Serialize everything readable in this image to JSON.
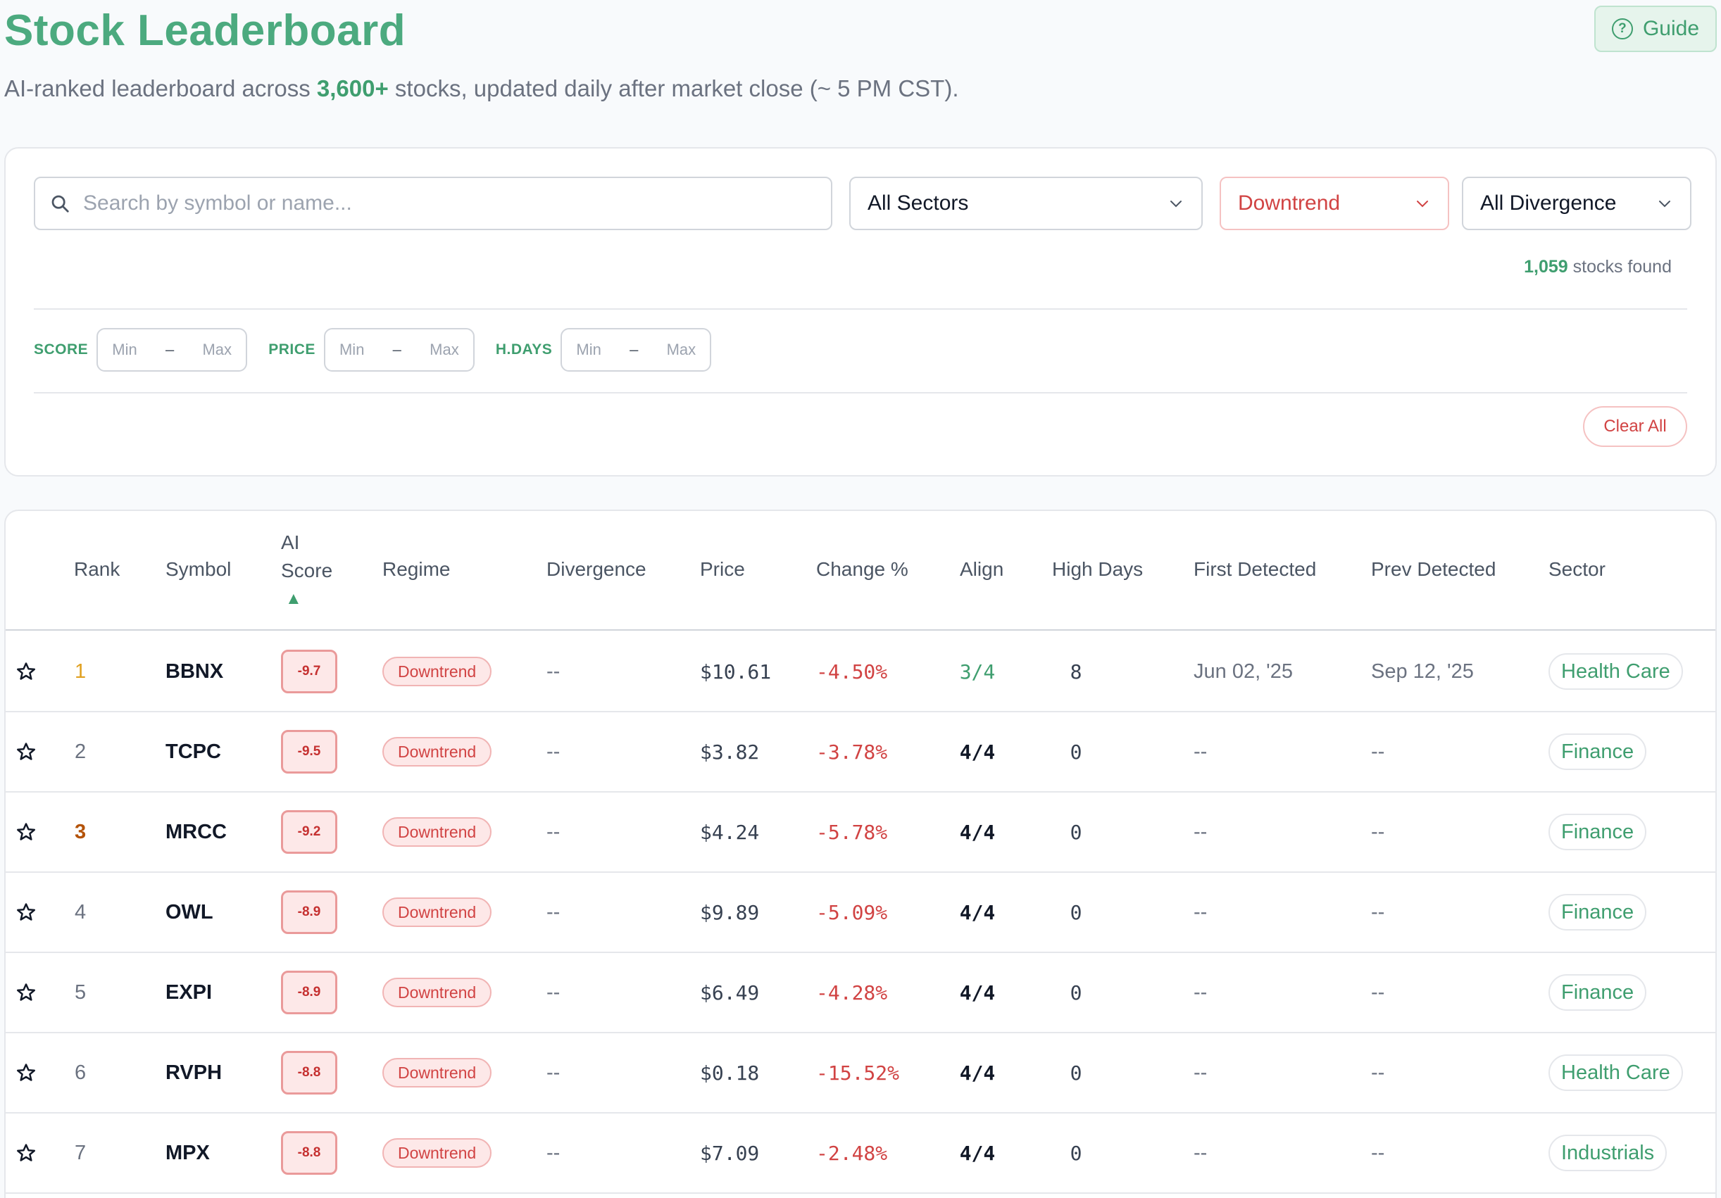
{
  "header": {
    "title": "Stock Leaderboard",
    "subtitle_pre": "AI-ranked leaderboard across ",
    "subtitle_highlight": "3,600+",
    "subtitle_post": " stocks, updated daily after market close (~ 5 PM CST).",
    "guide_label": "Guide"
  },
  "filters": {
    "search_placeholder": "Search by symbol or name...",
    "sector_value": "All Sectors",
    "regime_value": "Downtrend",
    "divergence_value": "All Divergence",
    "found_count": "1,059",
    "found_suffix": " stocks found",
    "ranges": [
      {
        "label": "SCORE",
        "min": "Min",
        "max": "Max"
      },
      {
        "label": "PRICE",
        "min": "Min",
        "max": "Max"
      },
      {
        "label": "H.DAYS",
        "min": "Min",
        "max": "Max"
      }
    ],
    "clear_label": "Clear All"
  },
  "table": {
    "headers": {
      "rank": "Rank",
      "symbol": "Symbol",
      "ai_score_1": "AI",
      "ai_score_2": "Score",
      "ai_score_arrow": "▲",
      "regime": "Regime",
      "divergence": "Divergence",
      "price": "Price",
      "change": "Change %",
      "align": "Align",
      "high_days": "High Days",
      "first_detected": "First Detected",
      "prev_detected": "Prev Detected",
      "sector": "Sector"
    },
    "rows": [
      {
        "rank": "1",
        "symbol": "BBNX",
        "score": "-9.7",
        "regime": "Downtrend",
        "divergence": "--",
        "price": "$10.61",
        "change": "-4.50%",
        "align": "3/4",
        "high_days": "8",
        "first": "Jun 02, '25",
        "prev": "Sep 12, '25",
        "sector": "Health Care"
      },
      {
        "rank": "2",
        "symbol": "TCPC",
        "score": "-9.5",
        "regime": "Downtrend",
        "divergence": "--",
        "price": "$3.82",
        "change": "-3.78%",
        "align": "4/4",
        "high_days": "0",
        "first": "--",
        "prev": "--",
        "sector": "Finance"
      },
      {
        "rank": "3",
        "symbol": "MRCC",
        "score": "-9.2",
        "regime": "Downtrend",
        "divergence": "--",
        "price": "$4.24",
        "change": "-5.78%",
        "align": "4/4",
        "high_days": "0",
        "first": "--",
        "prev": "--",
        "sector": "Finance"
      },
      {
        "rank": "4",
        "symbol": "OWL",
        "score": "-8.9",
        "regime": "Downtrend",
        "divergence": "--",
        "price": "$9.89",
        "change": "-5.09%",
        "align": "4/4",
        "high_days": "0",
        "first": "--",
        "prev": "--",
        "sector": "Finance"
      },
      {
        "rank": "5",
        "symbol": "EXPI",
        "score": "-8.9",
        "regime": "Downtrend",
        "divergence": "--",
        "price": "$6.49",
        "change": "-4.28%",
        "align": "4/4",
        "high_days": "0",
        "first": "--",
        "prev": "--",
        "sector": "Finance"
      },
      {
        "rank": "6",
        "symbol": "RVPH",
        "score": "-8.8",
        "regime": "Downtrend",
        "divergence": "--",
        "price": "$0.18",
        "change": "-15.52%",
        "align": "4/4",
        "high_days": "0",
        "first": "--",
        "prev": "--",
        "sector": "Health Care"
      },
      {
        "rank": "7",
        "symbol": "MPX",
        "score": "-8.8",
        "regime": "Downtrend",
        "divergence": "--",
        "price": "$7.09",
        "change": "-2.48%",
        "align": "4/4",
        "high_days": "0",
        "first": "--",
        "prev": "--",
        "sector": "Industrials"
      }
    ]
  },
  "colors": {
    "brand_green": "#4caa7f",
    "down_red": "#d14343",
    "gold_rank": "#e0a020",
    "bronze_rank": "#b45309"
  },
  "icons": {
    "search": "search-icon",
    "chevron": "chevron-down-icon",
    "help": "help-circle-icon",
    "star": "star-outline-icon"
  }
}
